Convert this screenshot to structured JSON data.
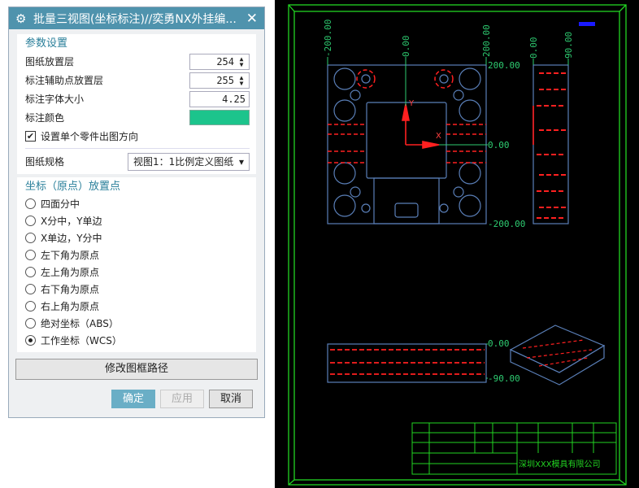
{
  "dialog": {
    "title": "批量三视图(坐标标注)//奕勇NX外挂编...",
    "icons": {
      "title": "gear-icon",
      "close": "close-icon"
    },
    "close_label": "✕",
    "params": {
      "section": "参数设置",
      "sheet_layer_label": "图纸放置层",
      "sheet_layer": "254",
      "aux_layer_label": "标注辅助点放置层",
      "aux_layer": "255",
      "font_size_label": "标注字体大小",
      "font_size": "4.25",
      "color_label": "标注颜色",
      "color": "#1cc48c",
      "orient_label": "设置单个零件出图方向",
      "orient_checked": true,
      "spec_label": "图纸规格",
      "spec_value": "视图1：1比例定义图纸"
    },
    "origin": {
      "section": "坐标（原点）放置点",
      "options": [
        "四面分中",
        "X分中，Y单边",
        "X单边，Y分中",
        "左下角为原点",
        "左上角为原点",
        "右下角为原点",
        "右上角为原点",
        "绝对坐标（ABS）",
        "工作坐标（WCS）"
      ],
      "selected": "工作坐标（WCS）"
    },
    "modify_path": "修改图框路径",
    "ok": "确定",
    "apply": "应用",
    "cancel": "取消"
  },
  "drawing": {
    "top_dims": [
      "-200.00",
      "0.00",
      "200.00",
      "0.00",
      "90.00"
    ],
    "right_dims": [
      "200.00",
      "0.00",
      "-200.00"
    ],
    "bottom_dims": [
      "0.00",
      "-90.00"
    ],
    "axis_y": "Y",
    "axis_x": "X",
    "company": "深圳XXX模具有限公司",
    "colors": {
      "frame": "#22d422",
      "dims": "#2ecc71",
      "part": "#5a7fb8",
      "features": "#ff2020",
      "text": "#1a1aff"
    }
  }
}
